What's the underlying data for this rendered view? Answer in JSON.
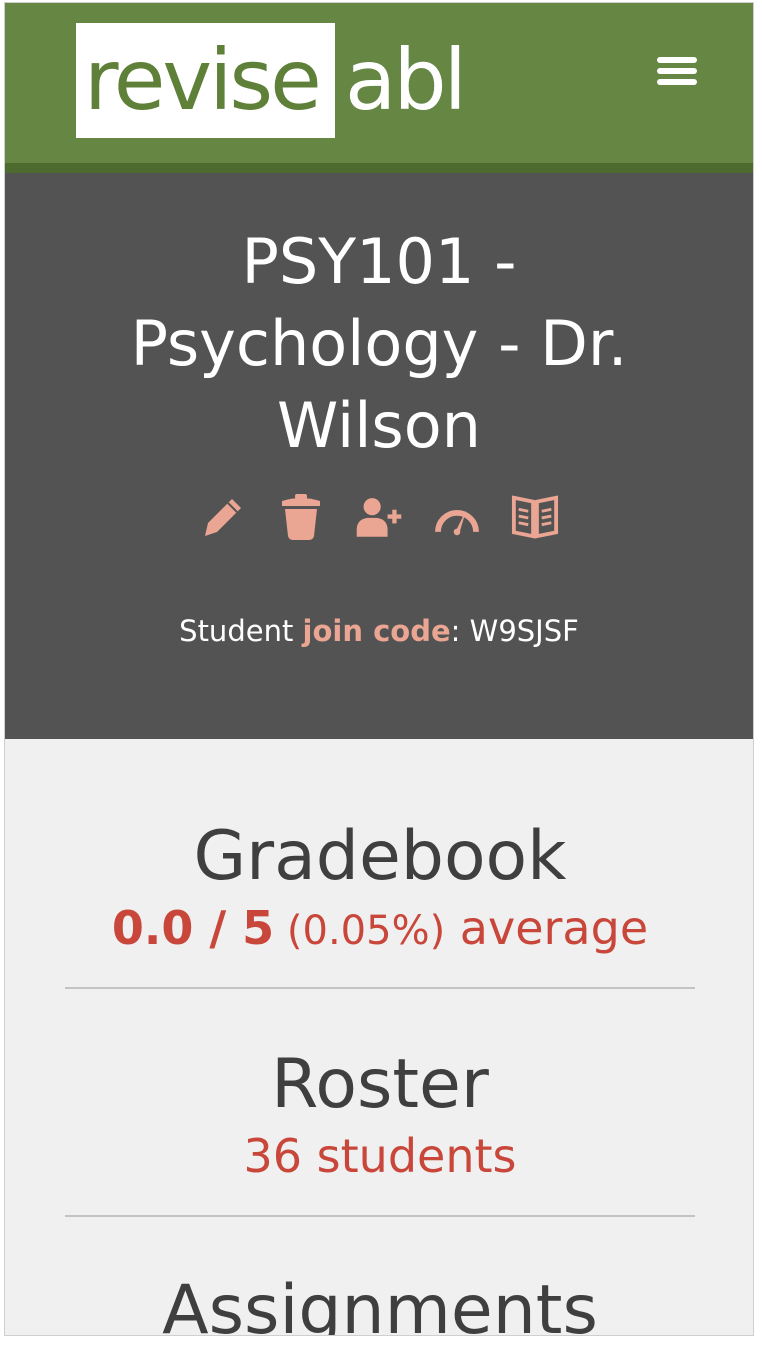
{
  "header": {
    "logo_left": "revise",
    "logo_right": "abl",
    "menu_icon": "hamburger-menu-icon"
  },
  "course": {
    "title": "PSY101 - Psychology - Dr. Wilson",
    "actions": [
      {
        "icon": "pencil-icon"
      },
      {
        "icon": "trash-icon"
      },
      {
        "icon": "add-user-icon"
      },
      {
        "icon": "speedometer-icon"
      },
      {
        "icon": "book-icon"
      }
    ],
    "join_prefix": "Student ",
    "join_link": "join code",
    "join_sep": ": ",
    "join_code": "W9SJSF"
  },
  "sections": {
    "gradebook": {
      "title": "Gradebook",
      "score": "0.0 / 5",
      "percent": " (0.05%)",
      "suffix": " average"
    },
    "roster": {
      "title": "Roster",
      "count": "36 students"
    },
    "assignments": {
      "title": "Assignments"
    }
  },
  "colors": {
    "header_green": "#668643",
    "hero_gray": "#535353",
    "accent_salmon": "#eaa593",
    "accent_red": "#c9473a"
  }
}
